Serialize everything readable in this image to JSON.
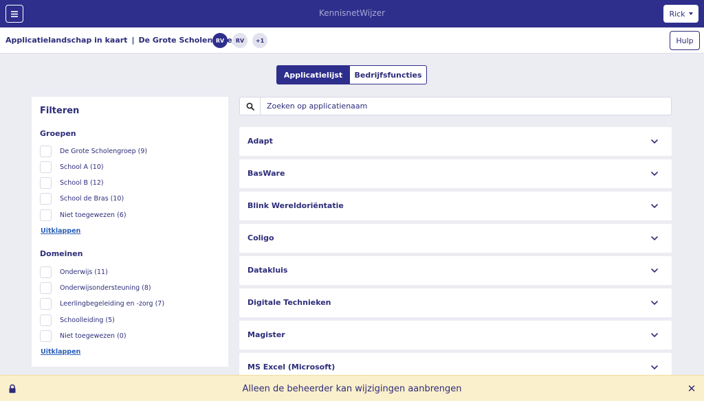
{
  "topbar": {
    "title": "KennisnetWijzer",
    "user_label": "Rick",
    "menu_icon": "hamburger-icon"
  },
  "subbar": {
    "breadcrumb_part1": "Applicatielandschap in kaart",
    "breadcrumb_separator": "|",
    "breadcrumb_part2": "De Grote Scholengroep",
    "avatars": [
      "RV",
      "RV",
      "+1"
    ],
    "help_label": "Hulp"
  },
  "tabs": [
    {
      "label": "Applicatielijst",
      "active": true
    },
    {
      "label": "Bedrijfsfuncties",
      "active": false
    }
  ],
  "filters": {
    "title": "Filteren",
    "groups": {
      "title": "Groepen",
      "items": [
        "De Grote Scholengroep (9)",
        "School A (10)",
        "School B (12)",
        "School de Bras (10)",
        "Niet toegewezen (6)"
      ],
      "expand_label": "Uitklappen"
    },
    "domains": {
      "title": "Domeinen",
      "items": [
        "Onderwijs (11)",
        "Onderwijsondersteuning (8)",
        "Leerlingbegeleiding en -zorg (7)",
        "Schoolleiding (5)",
        "Niet toegewezen (0)"
      ],
      "expand_label": "Uitklappen"
    }
  },
  "search": {
    "placeholder": "Zoeken op applicatienaam",
    "icon": "search-icon"
  },
  "applications": [
    "Adapt",
    "BasWare",
    "Blink Wereldoriëntatie",
    "Coligo",
    "Datakluis",
    "Digitale Technieken",
    "Magister",
    "MS Excel (Microsoft)"
  ],
  "notice": {
    "text": "Alleen de beheerder kan wijzigingen aanbrengen",
    "close_symbol": "✕"
  },
  "colors": {
    "primary": "#2e2e8c",
    "background": "#ececf3",
    "notice": "#fbf0cc",
    "link": "#2b5fb8"
  }
}
